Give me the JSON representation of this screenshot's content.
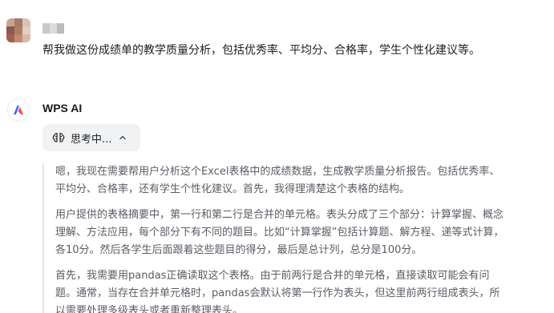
{
  "user": {
    "message": "帮我做这份成绩单的教学质量分析，包括优秀率、平均分、合格率，学生个性化建议等。"
  },
  "assistant": {
    "name": "WPS AI",
    "thinking_label": "思考中...",
    "reasoning": [
      {
        "lines": [
          "嗯，我现在需要帮用户分析这个Excel表格中的成绩数据，生成教学质量分析报告。包括优秀率、",
          "平均分、合格率，还有学生个性化建议。首先，我得理清楚这个表格的结构。"
        ]
      },
      {
        "lines": [
          "用户提供的表格摘要中，第一行和第二行是合并的单元格。表头分成了三个部分：计算掌握、概念",
          "理解、方法应用，每个部分下有不同的题目。比如“计算掌握”包括计算题、解方程、递等式计算，",
          "各10分。然后各学生后面跟着这些题目的得分，最后是总计列，总分是100分。"
        ]
      },
      {
        "lines": [
          "首先，我需要用pandas正确读取这个表格。由于前两行是合并的单元格，直接读取可能会有问",
          "题。通常，当存在合并单元格时，pandas会默认将第一行作为表头，但这里前两行组成表头，所",
          "以需要处理多级表头或者重新整理表头。"
        ]
      }
    ]
  },
  "icons": {
    "user_avatar": "pixelated-avatar-icon",
    "ai_avatar": "wps-ai-logo-icon",
    "thinking": "brain-icon",
    "collapse": "chevron-up-icon"
  },
  "colors": {
    "accent_blue": "#3b6cff",
    "accent_red": "#ff4d4f",
    "chip_bg": "#f1f2f4",
    "reasoning_text": "#5c5c66",
    "reasoning_border": "#e5e6ea"
  }
}
